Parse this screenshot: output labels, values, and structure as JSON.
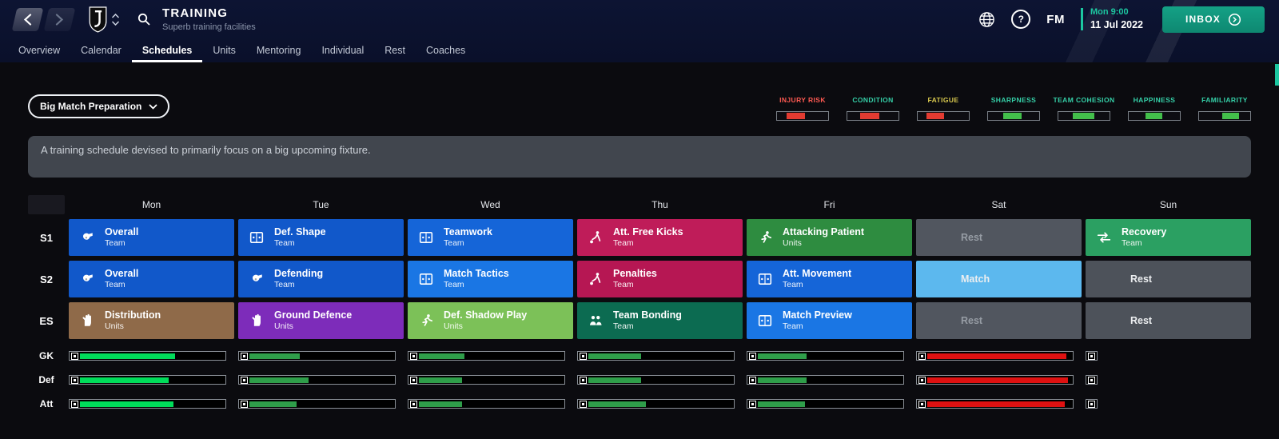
{
  "header": {
    "title": "TRAINING",
    "subtitle": "Superb training facilities",
    "clock_day": "Mon 9:00",
    "clock_date": "11 Jul 2022",
    "inbox_label": "INBOX",
    "fm_badge": "FM",
    "help_glyph": "?"
  },
  "tabs": [
    {
      "label": "Overview",
      "active": false
    },
    {
      "label": "Calendar",
      "active": false
    },
    {
      "label": "Schedules",
      "active": true
    },
    {
      "label": "Units",
      "active": false
    },
    {
      "label": "Mentoring",
      "active": false
    },
    {
      "label": "Individual",
      "active": false
    },
    {
      "label": "Rest",
      "active": false
    },
    {
      "label": "Coaches",
      "active": false
    }
  ],
  "schedule_selector": {
    "value": "Big Match Preparation"
  },
  "description": "A training schedule devised to primarily focus on a big upcoming fixture.",
  "meters": [
    {
      "label": "INJURY RISK",
      "label_color": "#ff5a52",
      "fill_color": "#e23b31",
      "start": 18,
      "end": 55
    },
    {
      "label": "CONDITION",
      "label_color": "#35d0a8",
      "fill_color": "#e23b31",
      "start": 25,
      "end": 62
    },
    {
      "label": "FATIGUE",
      "label_color": "#d9c94e",
      "fill_color": "#e23b31",
      "start": 17,
      "end": 52
    },
    {
      "label": "SHARPNESS",
      "label_color": "#35d0a8",
      "fill_color": "#43bf4b",
      "start": 30,
      "end": 66
    },
    {
      "label": "TEAM COHESION",
      "label_color": "#35d0a8",
      "fill_color": "#43bf4b",
      "start": 28,
      "end": 70
    },
    {
      "label": "HAPPINESS",
      "label_color": "#35d0a8",
      "fill_color": "#43bf4b",
      "start": 33,
      "end": 66
    },
    {
      "label": "FAMILIARITY",
      "label_color": "#35d0a8",
      "fill_color": "#43bf4b",
      "start": 45,
      "end": 78
    }
  ],
  "days": [
    "Mon",
    "Tue",
    "Wed",
    "Thu",
    "Fri",
    "Sat",
    "Sun"
  ],
  "schedule_rows": [
    {
      "label": "S1",
      "cells": [
        {
          "kind": "session",
          "title": "Overall",
          "unit": "Team",
          "bg": "#1158ca",
          "icon": "whistle"
        },
        {
          "kind": "session",
          "title": "Def. Shape",
          "unit": "Team",
          "bg": "#1158ca",
          "icon": "board"
        },
        {
          "kind": "session",
          "title": "Teamwork",
          "unit": "Team",
          "bg": "#1565d8",
          "icon": "board"
        },
        {
          "kind": "session",
          "title": "Att. Free Kicks",
          "unit": "Team",
          "bg": "#bf1c59",
          "icon": "kick"
        },
        {
          "kind": "session",
          "title": "Attacking Patient",
          "unit": "Units",
          "bg": "#2e8c40",
          "icon": "runner"
        },
        {
          "kind": "text",
          "title": "Rest",
          "variant": "dim",
          "bg": "#51565f"
        },
        {
          "kind": "session",
          "title": "Recovery",
          "unit": "Team",
          "bg": "#2ba062",
          "icon": "arrows"
        }
      ]
    },
    {
      "label": "S2",
      "cells": [
        {
          "kind": "session",
          "title": "Overall",
          "unit": "Team",
          "bg": "#1158ca",
          "icon": "whistle"
        },
        {
          "kind": "session",
          "title": "Defending",
          "unit": "Team",
          "bg": "#1158ca",
          "icon": "whistle"
        },
        {
          "kind": "session",
          "title": "Match Tactics",
          "unit": "Team",
          "bg": "#1a76e4",
          "icon": "board"
        },
        {
          "kind": "session",
          "title": "Penalties",
          "unit": "Team",
          "bg": "#b61753",
          "icon": "kick"
        },
        {
          "kind": "session",
          "title": "Att. Movement",
          "unit": "Team",
          "bg": "#1565d8",
          "icon": "board"
        },
        {
          "kind": "text",
          "title": "Match",
          "variant": "bright",
          "bg": "#5cb8ee"
        },
        {
          "kind": "text",
          "title": "Rest",
          "variant": "bright",
          "bg": "#4d525a"
        }
      ]
    },
    {
      "label": "ES",
      "cells": [
        {
          "kind": "session",
          "title": "Distribution",
          "unit": "Units",
          "bg": "#8f6a49",
          "icon": "glove"
        },
        {
          "kind": "session",
          "title": "Ground Defence",
          "unit": "Units",
          "bg": "#7d2cba",
          "icon": "glove"
        },
        {
          "kind": "session",
          "title": "Def. Shadow Play",
          "unit": "Units",
          "bg": "#7cc158",
          "icon": "runner"
        },
        {
          "kind": "session",
          "title": "Team Bonding",
          "unit": "Team",
          "bg": "#0c6b51",
          "icon": "players"
        },
        {
          "kind": "session",
          "title": "Match Preview",
          "unit": "Team",
          "bg": "#1a76e4",
          "icon": "board"
        },
        {
          "kind": "text",
          "title": "Rest",
          "variant": "dim",
          "bg": "#51565f"
        },
        {
          "kind": "text",
          "title": "Rest",
          "variant": "bright",
          "bg": "#4d525a"
        }
      ]
    }
  ],
  "workload_rows": [
    {
      "label": "GK",
      "bars": [
        {
          "pct": 66,
          "color": "#00dc5a"
        },
        {
          "pct": 35,
          "color": "#2f9e4a"
        },
        {
          "pct": 32,
          "color": "#2f9e4a"
        },
        {
          "pct": 37,
          "color": "#2f9e4a"
        },
        {
          "pct": 34,
          "color": "#2f9e4a"
        },
        {
          "pct": 97,
          "color": "#de1111"
        },
        {
          "stub": true
        }
      ]
    },
    {
      "label": "Def",
      "bars": [
        {
          "pct": 62,
          "color": "#00dc5a"
        },
        {
          "pct": 41,
          "color": "#2f9e4a"
        },
        {
          "pct": 30,
          "color": "#2f9e4a"
        },
        {
          "pct": 37,
          "color": "#2f9e4a"
        },
        {
          "pct": 34,
          "color": "#2f9e4a"
        },
        {
          "pct": 98,
          "color": "#de1111"
        },
        {
          "stub": true
        }
      ]
    },
    {
      "label": "Att",
      "bars": [
        {
          "pct": 65,
          "color": "#00dc5a"
        },
        {
          "pct": 33,
          "color": "#2f9e4a"
        },
        {
          "pct": 30,
          "color": "#2f9e4a"
        },
        {
          "pct": 40,
          "color": "#2f9e4a"
        },
        {
          "pct": 33,
          "color": "#2f9e4a"
        },
        {
          "pct": 96,
          "color": "#de1111"
        },
        {
          "stub": true
        }
      ]
    }
  ]
}
